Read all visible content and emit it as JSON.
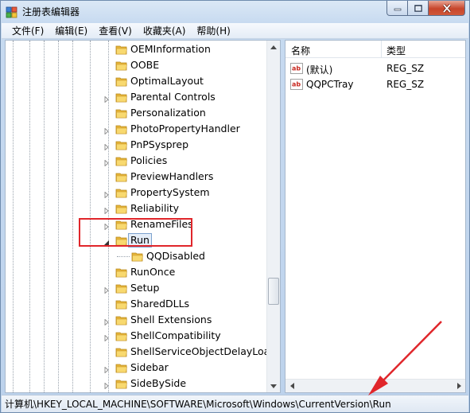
{
  "window": {
    "title": "注册表编辑器"
  },
  "menu": [
    {
      "label": "文件(F)"
    },
    {
      "label": "编辑(E)"
    },
    {
      "label": "查看(V)"
    },
    {
      "label": "收藏夹(A)"
    },
    {
      "label": "帮助(H)"
    }
  ],
  "tree": {
    "items": [
      {
        "label": "OEMInformation",
        "expandable": false
      },
      {
        "label": "OOBE",
        "expandable": false
      },
      {
        "label": "OptimalLayout",
        "expandable": false
      },
      {
        "label": "Parental Controls",
        "expandable": true
      },
      {
        "label": "Personalization",
        "expandable": false
      },
      {
        "label": "PhotoPropertyHandler",
        "expandable": true
      },
      {
        "label": "PnPSysprep",
        "expandable": true
      },
      {
        "label": "Policies",
        "expandable": true
      },
      {
        "label": "PreviewHandlers",
        "expandable": false
      },
      {
        "label": "PropertySystem",
        "expandable": true
      },
      {
        "label": "Reliability",
        "expandable": true
      },
      {
        "label": "RenameFiles",
        "expandable": true
      },
      {
        "label": "Run",
        "expandable": true,
        "expanded": true,
        "selected": true
      },
      {
        "label": "QQDisabled",
        "expandable": false,
        "child": true
      },
      {
        "label": "RunOnce",
        "expandable": false
      },
      {
        "label": "Setup",
        "expandable": true
      },
      {
        "label": "SharedDLLs",
        "expandable": false
      },
      {
        "label": "Shell Extensions",
        "expandable": true
      },
      {
        "label": "ShellCompatibility",
        "expandable": true
      },
      {
        "label": "ShellServiceObjectDelayLoad",
        "expandable": false
      },
      {
        "label": "Sidebar",
        "expandable": true
      },
      {
        "label": "SideBySide",
        "expandable": true
      }
    ]
  },
  "list": {
    "columns": {
      "name": "名称",
      "type": "类型"
    },
    "rows": [
      {
        "name": "(默认)",
        "type": "REG_SZ"
      },
      {
        "name": "QQPCTray",
        "type": "REG_SZ"
      }
    ]
  },
  "status": {
    "path": "计算机\\HKEY_LOCAL_MACHINE\\SOFTWARE\\Microsoft\\Windows\\CurrentVersion\\Run"
  },
  "colors": {
    "highlight": "#e0262b",
    "folder": "#f5c84c",
    "selection": "#e5eef9"
  },
  "icons": {
    "app": "regedit-icon",
    "folder": "folder-icon",
    "string_value": "ab-string-icon",
    "minimize": "minimize-icon",
    "maximize": "maximize-icon",
    "close": "close-icon"
  }
}
